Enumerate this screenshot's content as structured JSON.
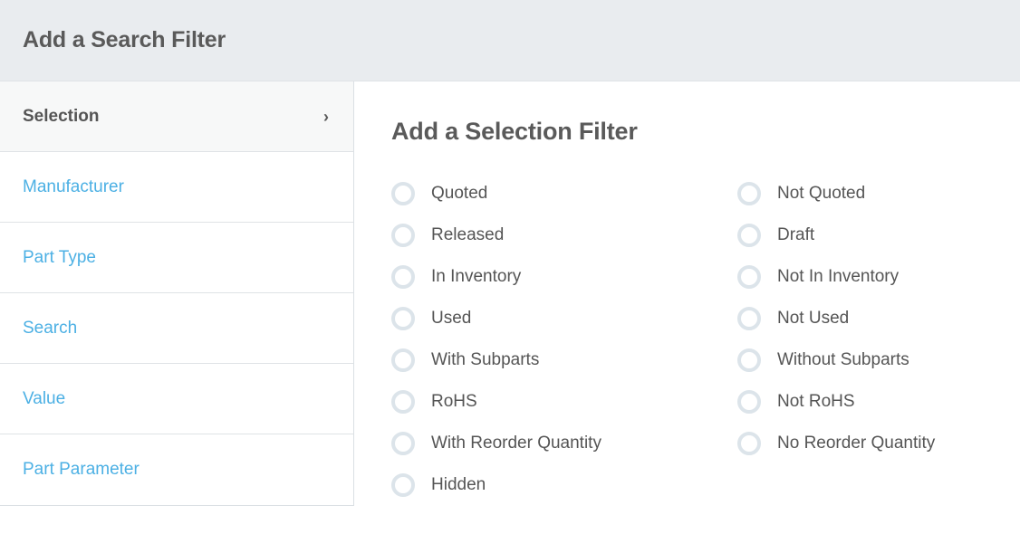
{
  "header": {
    "title": "Add a Search Filter"
  },
  "sidebar": {
    "items": [
      {
        "label": "Selection",
        "active": true,
        "chevron": "›",
        "icon_name": "chevron-right-icon"
      },
      {
        "label": "Manufacturer",
        "active": false,
        "chevron": "",
        "icon_name": ""
      },
      {
        "label": "Part Type",
        "active": false,
        "chevron": "",
        "icon_name": ""
      },
      {
        "label": "Search",
        "active": false,
        "chevron": "",
        "icon_name": ""
      },
      {
        "label": "Value",
        "active": false,
        "chevron": "",
        "icon_name": ""
      },
      {
        "label": "Part Parameter",
        "active": false,
        "chevron": "",
        "icon_name": ""
      }
    ]
  },
  "main": {
    "title": "Add a Selection Filter",
    "options_left": [
      {
        "label": "Quoted",
        "selected": false
      },
      {
        "label": "Released",
        "selected": false
      },
      {
        "label": "In Inventory",
        "selected": false
      },
      {
        "label": "Used",
        "selected": false
      },
      {
        "label": "With Subparts",
        "selected": false
      },
      {
        "label": "RoHS",
        "selected": false
      },
      {
        "label": "With Reorder Quantity",
        "selected": false
      },
      {
        "label": "Hidden",
        "selected": false
      }
    ],
    "options_right": [
      {
        "label": "Not Quoted",
        "selected": false
      },
      {
        "label": "Draft",
        "selected": false
      },
      {
        "label": "Not In Inventory",
        "selected": false
      },
      {
        "label": "Not Used",
        "selected": false
      },
      {
        "label": "Without Subparts",
        "selected": false
      },
      {
        "label": "Not RoHS",
        "selected": false
      },
      {
        "label": "No Reorder Quantity",
        "selected": false
      }
    ]
  },
  "colors": {
    "link_blue": "#4cb0e4",
    "header_bg": "#e9ecef",
    "text_gray": "#555555",
    "radio_ring": "#dce4ea",
    "divider": "#dfe3e6"
  }
}
